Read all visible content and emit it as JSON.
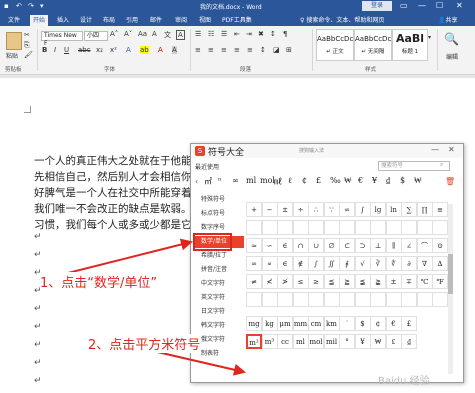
{
  "window": {
    "title": "我的文档.docx - Word",
    "login": "登录",
    "controls": [
      "—",
      "☐",
      "✕"
    ],
    "quick_access": [
      "💾",
      "↶",
      "↷",
      "▾"
    ]
  },
  "tabs": [
    "文件",
    "开始",
    "插入",
    "设计",
    "布局",
    "引用",
    "邮件",
    "审阅",
    "视图",
    "PDF工具集"
  ],
  "active_tab": "开始",
  "tell_me": "搜索命令、文本、帮助和网页",
  "share": "共享",
  "ribbon": {
    "paste": "粘贴",
    "clipboard_label": "剪贴板",
    "font_name": "Times New F",
    "font_size": "小四",
    "font_label": "字体",
    "paragraph_label": "段落",
    "styles": [
      {
        "sample": "AaBbCcDc",
        "name": "↵ 正文"
      },
      {
        "sample": "AaBbCcDc",
        "name": "↵ 无间隔"
      },
      {
        "sample": "AaBl",
        "name": "标题 1"
      }
    ],
    "styles_label": "样式",
    "edit": "编辑"
  },
  "document": {
    "lines": [
      "一个人的真正伟大之处就在于他能",
      "先相信自己，然后别人才会相信你",
      "好脾气是一个人在社交中所能穿着",
      "我们唯一不会改正的缺点是软弱。",
      "习惯，我们每个人或多或少都是它"
    ],
    "para_mark": "↵"
  },
  "dialog": {
    "title": "符号大全",
    "ime": "搜狗输入法",
    "recent_label": "最近使用",
    "search_placeholder": "搜索符号",
    "recent_symbols": [
      "㎡",
      "ⁿ",
      "∞",
      "ml",
      "mol",
      "㎖",
      "ℓ",
      "¢",
      "£",
      "‰",
      "₩",
      "€",
      "¥",
      "₫",
      "$",
      "₩"
    ],
    "categories": [
      "特殊符号",
      "标点符号",
      "数字序号",
      "数学/单位",
      "希腊/拉丁",
      "拼音/注音",
      "中文字符",
      "英文字符",
      "日文字符",
      "韩文字符",
      "俄文字符",
      "制表符"
    ],
    "selected_category": "数学/单位",
    "grid_row1": [
      "+",
      "−",
      "±",
      "÷",
      "∴",
      "∵",
      "∞",
      "∫",
      "lg",
      "ln",
      "∑",
      "∏",
      "≡"
    ],
    "grid_row3": [
      "≈",
      "∽",
      "∈",
      "∩",
      "∪",
      "∅",
      "⊂",
      "⊃",
      "⊥",
      "∥",
      "∠",
      "⌒",
      "⊙"
    ],
    "grid_row4": [
      "∞",
      "∝",
      "∈",
      "∉",
      "∫",
      "∬",
      "∮",
      "√",
      "∛",
      "∜",
      "∂",
      "∇",
      "∆"
    ],
    "grid_row5": [
      "≠",
      "≮",
      "≯",
      "≤",
      "≥",
      "≦",
      "≧",
      "≨",
      "≩",
      "±",
      "∓",
      "℃",
      "℉"
    ],
    "grid_row6": [
      "mg",
      "kg",
      "μm",
      "mm",
      "cm",
      "km",
      "′",
      "$",
      "¢",
      "€",
      "£"
    ],
    "grid_row7": [
      "m²",
      "m³",
      "cc",
      "ml",
      "mol",
      "mil",
      "°",
      "¥",
      "₩",
      "₤",
      "₫"
    ]
  },
  "annotations": {
    "step1": "1、点击“数学/单位”",
    "step2": "2、点击平方米符号"
  },
  "watermark": "Baidu 经验"
}
